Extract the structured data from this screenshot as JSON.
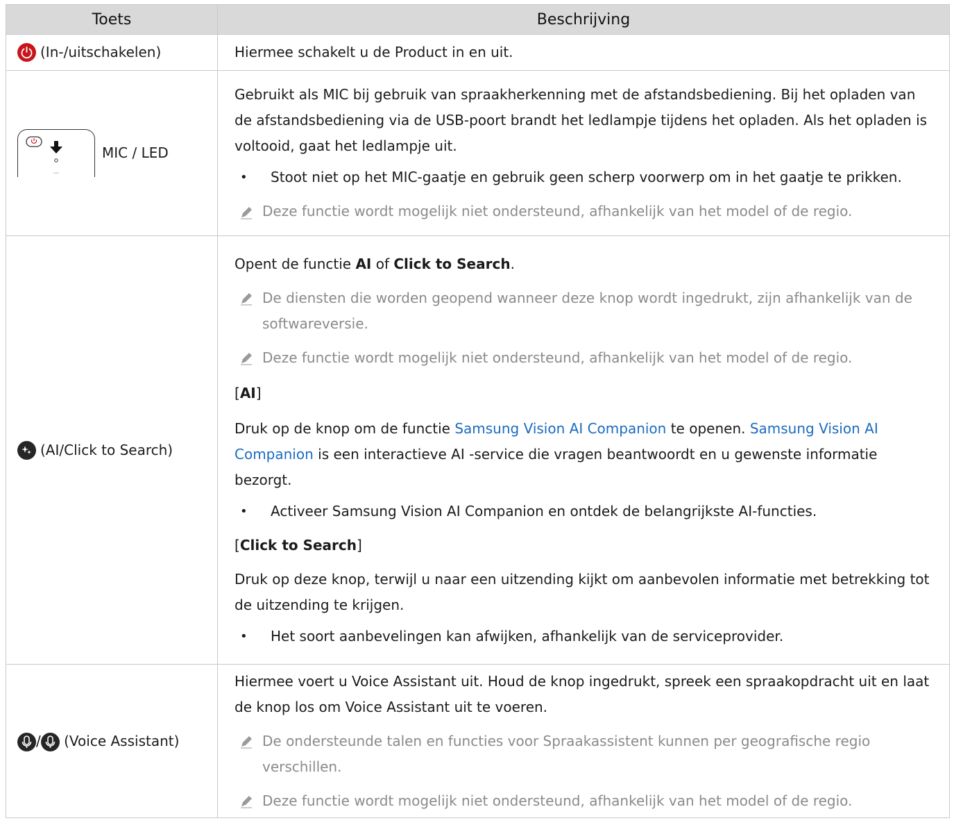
{
  "table": {
    "headers": {
      "key": "Toets",
      "desc": "Beschrijving"
    }
  },
  "rows": {
    "power": {
      "icon": "power-icon",
      "label": "(In-/uitschakelen)",
      "text": "Hiermee schakelt u de Product in en uit."
    },
    "mic": {
      "icon": "remote-mic-led-illustration",
      "label": "MIC / LED",
      "text": "Gebruikt als MIC bij gebruik van spraakherkenning met de afstandsbediening. Bij het opladen van de afstandsbediening via de USB-poort brandt het ledlampje tijdens het opladen. Als het opladen is voltooid, gaat het ledlampje uit.",
      "bullet": "Stoot niet op het MIC-gaatje en gebruik geen scherp voorwerp om in het gaatje te prikken.",
      "note": "Deze functie wordt mogelijk niet ondersteund, afhankelijk van het model of de regio."
    },
    "ai": {
      "icon": "ai-search-icon",
      "label": "(AI/Click to Search)",
      "intro_pre": "Opent de functie ",
      "intro_ai": "AI",
      "intro_of": " of ",
      "intro_cts": "Click to Search",
      "intro_end": ".",
      "note1": "De diensten die worden geopend wanneer deze knop wordt ingedrukt, zijn afhankelijk van de softwareversie.",
      "note2": "Deze functie wordt mogelijk niet ondersteund, afhankelijk van het model of de regio.",
      "ai_heading_open": "[",
      "ai_heading": "AI",
      "ai_heading_close": "]",
      "ai_text_pre": "Druk op de knop om de functie ",
      "ai_link1": "Samsung Vision AI Companion",
      "ai_text_mid": " te openen. ",
      "ai_link2": "Samsung Vision AI Companion",
      "ai_text_post": " is een interactieve AI -service die vragen beantwoordt en u gewenste informatie bezorgt.",
      "ai_bullet": "Activeer Samsung Vision AI Companion en ontdek de belangrijkste AI-functies.",
      "cts_heading_open": "[",
      "cts_heading": "Click to Search",
      "cts_heading_close": "]",
      "cts_text": "Druk op deze knop, terwijl u naar een uitzending kijkt om aanbevolen informatie met betrekking tot de uitzending te krijgen.",
      "cts_bullet": "Het soort aanbevelingen kan afwijken, afhankelijk van de serviceprovider."
    },
    "voice": {
      "icon": "microphone-icon",
      "slash": "/",
      "label": "(Voice Assistant)",
      "text": "Hiermee voert u Voice Assistant uit. Houd de knop ingedrukt, spreek een spraakopdracht uit en laat de knop los om Voice Assistant uit te voeren.",
      "note1": "De ondersteunde talen en functies voor Spraakassistent kunnen per geografische regio verschillen.",
      "note2": "Deze functie wordt mogelijk niet ondersteund, afhankelijk van het model of de regio."
    }
  },
  "bullet_char": "•"
}
